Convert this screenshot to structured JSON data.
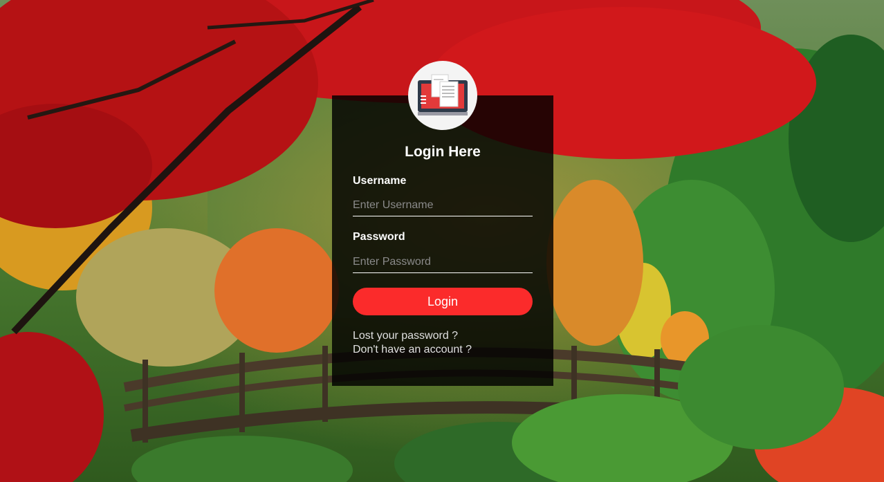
{
  "login": {
    "title": "Login Here",
    "username_label": "Username",
    "username_placeholder": "Enter Username",
    "password_label": "Password",
    "password_placeholder": "Enter Password",
    "login_button": "Login",
    "lost_password_link": "Lost your password ?",
    "signup_link": "Don't have an account ?"
  },
  "avatar": {
    "icon": "documents-monitor-icon"
  },
  "colors": {
    "box_background": "#000000",
    "button": "#fb2b2b",
    "avatar_background": "#f4f4f4"
  }
}
